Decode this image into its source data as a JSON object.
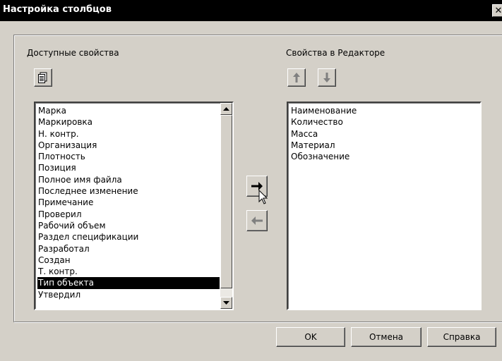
{
  "window": {
    "title": "Настройка столбцов",
    "close_label": "✕"
  },
  "left": {
    "label": "Доступные свойства",
    "items": [
      "Марка",
      "Маркировка",
      "Н. контр.",
      "Организация",
      "Плотность",
      "Позиция",
      "Полное имя файла",
      "Последнее изменение",
      "Примечание",
      "Проверил",
      "Рабочий объем",
      "Раздел спецификации",
      "Разработал",
      "Создан",
      "Т. контр.",
      "Тип объекта",
      "Утвердил"
    ],
    "selected": "Тип объекта"
  },
  "right": {
    "label": "Свойства в Редакторе",
    "items": [
      "Наименование",
      "Количество",
      "Масса",
      "Материал",
      "Обозначение"
    ]
  },
  "buttons": {
    "ok": "OK",
    "cancel": "Отмена",
    "help": "Справка"
  }
}
